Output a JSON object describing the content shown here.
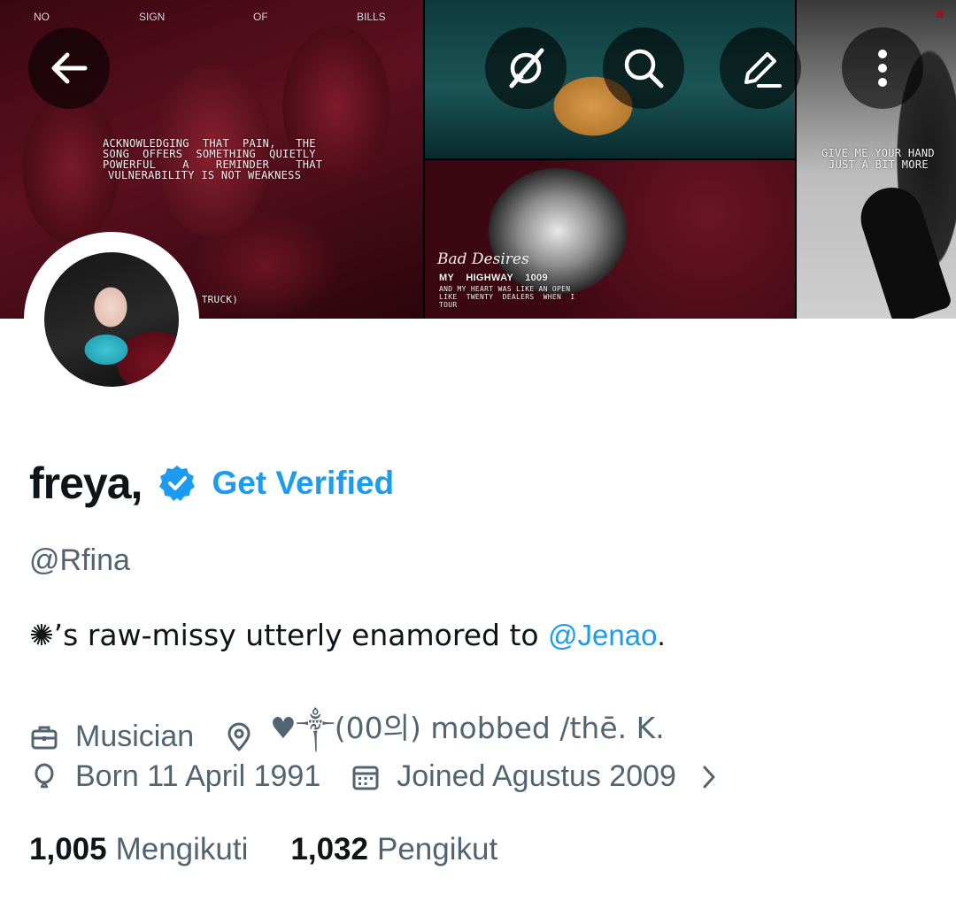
{
  "banner": {
    "top_words": [
      "NO",
      "SIGN",
      "OF",
      "BILLS"
    ],
    "quote_lines": [
      "ACKNOWLEDGING  THAT  PAIN,   THE",
      "SONG  OFFERS  SOMETHING  QUIETLY",
      "POWERFUL    A    REMINDER    THAT",
      "VULNERABILITY IS NOT WEAKNESS"
    ],
    "truck_text": "OON TRUCK)",
    "bad_desires": "Bad Desires",
    "highway": "MY    HIGHWAY    1009",
    "small_lines": [
      "AND MY HEART WAS LIKE AN OPEN",
      "LIKE  TWENTY  DEALERS  WHEN  I",
      "TOUR"
    ],
    "hand_lines": [
      "GIVE ME YOUR HAND",
      "JUST A BIT MORE"
    ]
  },
  "header": {
    "back_icon": "back-arrow-icon",
    "actions": [
      "grok-icon",
      "search-icon",
      "edit-icon",
      "more-vertical-icon"
    ]
  },
  "profile": {
    "name": "freya,",
    "verified_badge_color": "#1d9bf0",
    "get_verified_label": "Get Verified",
    "handle": "@Rfina",
    "bio_prefix": "✺’s raw-missy utterly enamored to ",
    "bio_mention": "@Jenao",
    "bio_suffix": ".",
    "category": "Musician",
    "location": "♥༒(00의) mobbed   /thē.   K.",
    "birthday": "Born 11 April 1991",
    "joined": "Joined Agustus 2009",
    "following_count": "1,005",
    "following_label": "Mengikuti",
    "followers_count": "1,032",
    "followers_label": "Pengikut"
  },
  "colors": {
    "accent": "#1d9bf0",
    "text_primary": "#0f1419",
    "text_secondary": "#536471"
  }
}
